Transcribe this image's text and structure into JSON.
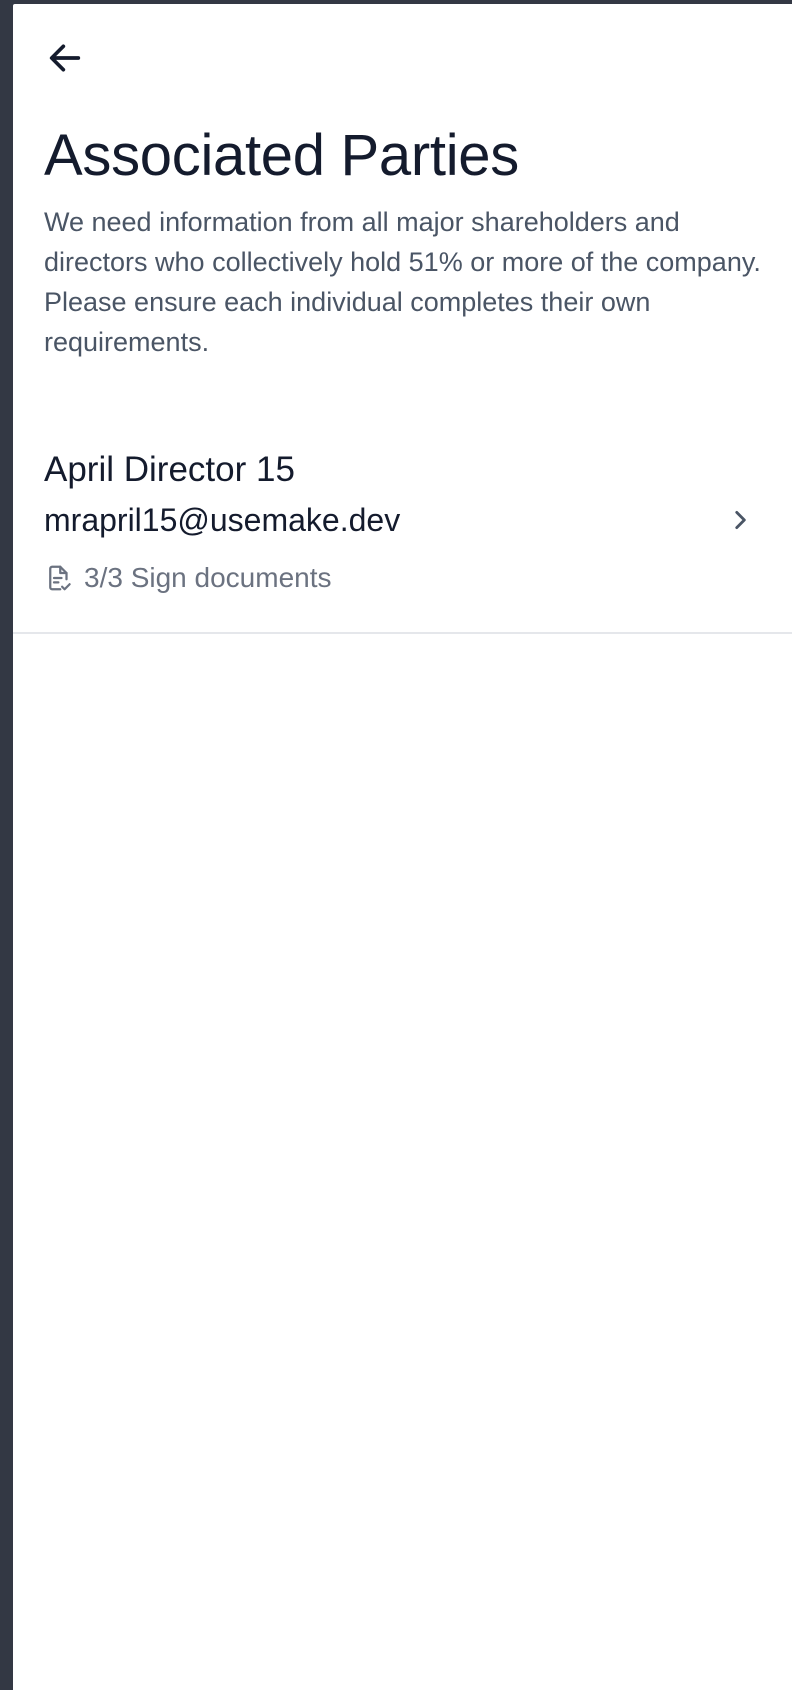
{
  "header": {
    "back_icon": "arrow-left-icon",
    "title": "Associated Parties",
    "description": "We need information from all major shareholders and directors who collectively hold 51% or more of the company. Please ensure each individual completes their own requirements."
  },
  "parties": [
    {
      "name": "April Director 15",
      "email": "mrapril15@usemake.dev",
      "status_icon": "document-check-icon",
      "status": "3/3 Sign documents",
      "chevron_icon": "chevron-right-icon"
    }
  ],
  "colors": {
    "backdrop": "#333844",
    "surface": "#ffffff",
    "text_primary": "#141b2d",
    "text_secondary": "#4a5565",
    "text_muted": "#6b7280",
    "divider": "#e5e7eb"
  }
}
